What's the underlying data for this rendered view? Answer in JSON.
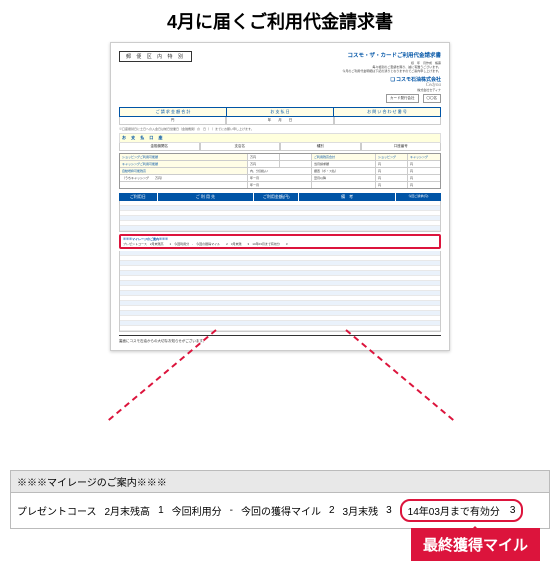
{
  "heading": "4月に届くご利用代金請求書",
  "postal_label": "郵 便 区 内 特 別",
  "brand": {
    "statement_title": "コスモ・ザ・カードご利用代金請求書",
    "fine1": "様　年　月作成　帳票",
    "fine2": "毎々格別のご愛顧を賜り、誠に有難うございます。",
    "fine3": "今月のご利用代金明細は下記の通りとなりますのでご案内申し上げます。",
    "cosmo": "コスモ石油株式会社",
    "cedyna": "Cedyna",
    "addr": "株式会社セディナ",
    "card_label": "カード発行会社",
    "member": "〇〇名"
  },
  "hdr": {
    "a": "ご 請 求 金 額 合 計",
    "b": "お 支 払 日",
    "c": "お 問 い 合 わ せ 番 号"
  },
  "sub": {
    "yen": "円",
    "ymd": "年　　月　　日"
  },
  "note_line": "※口座振替日に土日への入金日は前日営業日（金融機関）の　日（　）までにお願い申し上げます。",
  "bank_label": "お 支 払 口 座",
  "bank_sub": {
    "a": "金融機関名",
    "b": "支店名",
    "c": "種別",
    "d": "口座番号"
  },
  "shopping": {
    "sh": "ショッピングご利用可能額",
    "sk": "キャッシングご利用可能額",
    "auto": "自動増枠可能残高",
    "h1": "ご利用残高合計",
    "h2": "ショッピング",
    "h3": "キャッシング",
    "r1": "当月請求額",
    "r2": "据置（ボ・ス払）",
    "r3": "翌月以降",
    "r4": "年ー月　",
    "r5": "年ー月　",
    "n": "万円",
    "total": "内、分割払い",
    "cash": "（うちキャッシング　　万円）"
  },
  "use": {
    "a": "ご利用日",
    "b": "ご 利 用 先",
    "c": "ご利用金額(円)",
    "d": "備　考",
    "e": "今回ご請求(円)"
  },
  "hl": {
    "t": "※※※マイレージのご案内※※※",
    "row": "プレゼントコース　2月末残高　　1　今回利用分　-　今回の獲得マイル　　2　3月末残　　3　14年03月まで有効分　　3"
  },
  "footnote": "裏面にコスモ石油からの大切なお知らせがございます。",
  "zoom": {
    "head": "※※※マイレージのご案内※※※",
    "c1": "プレゼントコース",
    "c2": "2月末残高",
    "v2": "1",
    "c3": "今回利用分",
    "dash": "-",
    "c4": "今回の獲得マイル",
    "v4": "2",
    "c5": "3月末残",
    "v5": "3",
    "c6": "14年03月まで有効分",
    "v6": "3"
  },
  "tag": "最終獲得マイル"
}
